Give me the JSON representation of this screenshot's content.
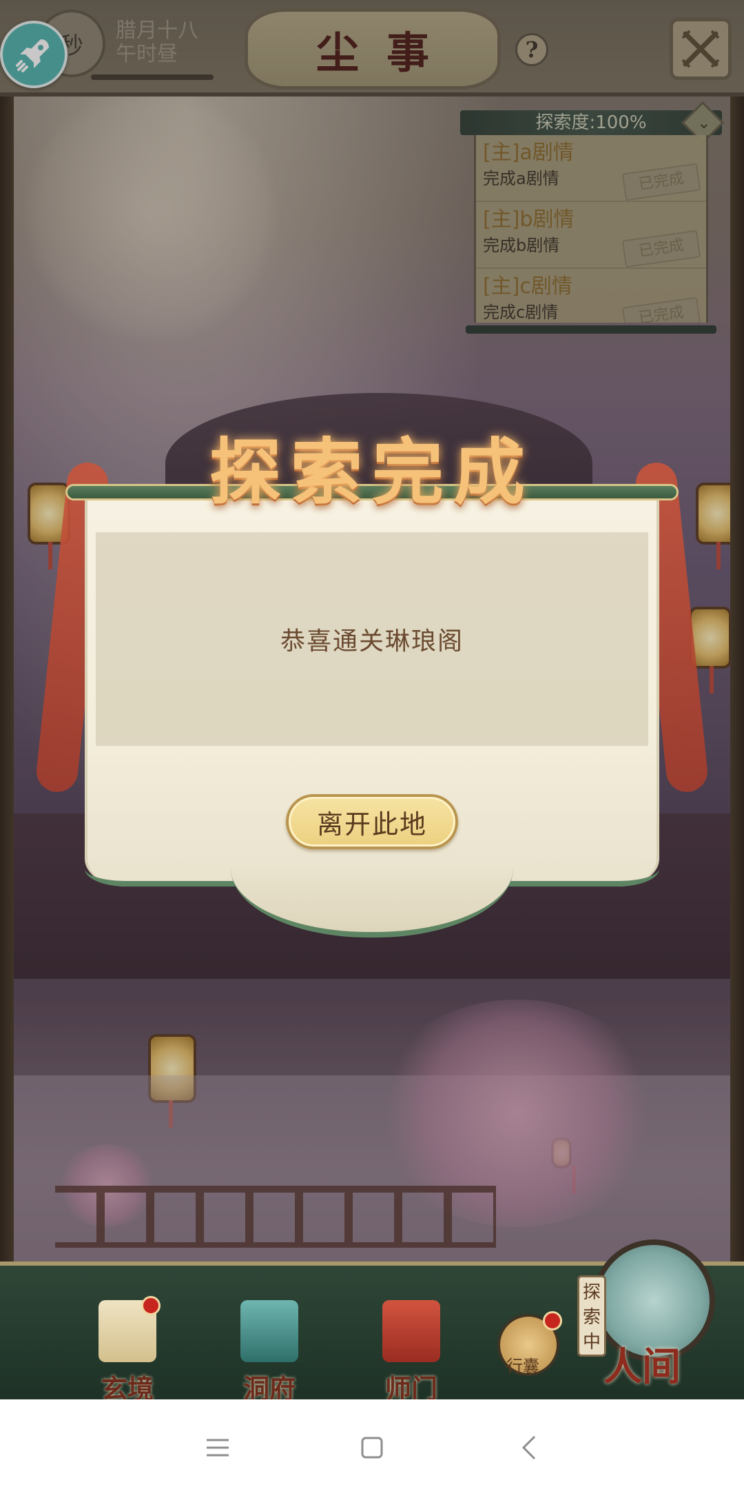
{
  "top_bar": {
    "timer_badge": "秒",
    "date_line1": "腊月十八",
    "date_line2": "午时昼",
    "title": "尘事",
    "help_glyph": "?"
  },
  "quest_panel": {
    "header": "探索度:100%",
    "items": [
      {
        "title": "[主]a剧情",
        "desc": "完成a剧情",
        "status": "已完成"
      },
      {
        "title": "[主]b剧情",
        "desc": "完成b剧情",
        "status": "已完成"
      },
      {
        "title": "[主]c剧情",
        "desc": "完成c剧情",
        "status": "已完成"
      }
    ]
  },
  "dialog": {
    "title": "探索完成",
    "message": "恭喜通关琳琅阁",
    "button": "离开此地"
  },
  "bottom_nav": {
    "items": [
      {
        "label": "玄境",
        "icon": "scroll-icon",
        "badge": true
      },
      {
        "label": "洞府",
        "icon": "pavilion-icon",
        "badge": false
      },
      {
        "label": "师门",
        "icon": "banner-icon",
        "badge": false
      }
    ],
    "bag_label": "行囊",
    "explore_tag": "探索中",
    "world_label": "人间"
  },
  "colors": {
    "dialog_title": "#f6c27a",
    "button_fill": "#ecd080",
    "nav_bg": "#2f4637",
    "badge_red": "#c7261e"
  }
}
